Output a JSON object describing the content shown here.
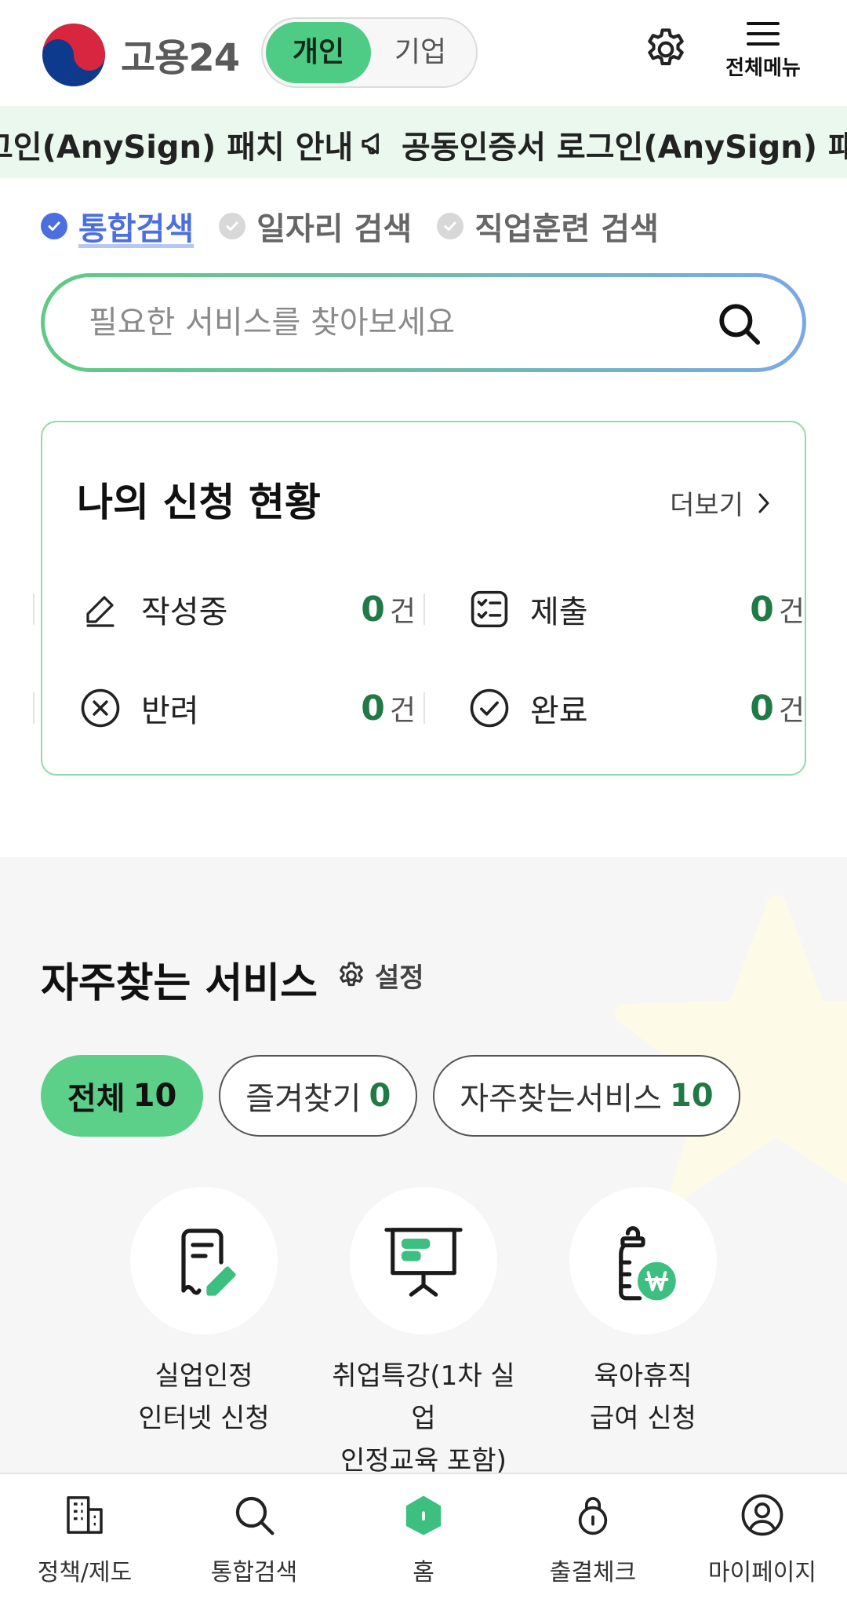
{
  "header": {
    "brand": "고용24",
    "toggle": {
      "personal": "개인",
      "business": "기업"
    },
    "menu_label": "전체메뉴"
  },
  "notice": {
    "text_1": "그인(AnySign) 패치 안내",
    "text_2": "공동인증서 로그인(AnySign) 패치"
  },
  "search_tabs": [
    "통합검색",
    "일자리 검색",
    "직업훈련 검색"
  ],
  "search": {
    "placeholder": "필요한 서비스를 찾아보세요"
  },
  "applications": {
    "title": "나의 신청 현황",
    "more": "더보기",
    "unit": "건",
    "items": [
      {
        "label": "작성중",
        "count": "0"
      },
      {
        "label": "제출",
        "count": "0"
      },
      {
        "label": "반려",
        "count": "0"
      },
      {
        "label": "완료",
        "count": "0"
      }
    ]
  },
  "frequent": {
    "title": "자주찾는 서비스",
    "settings": "설정",
    "chips": [
      {
        "label": "전체",
        "count": "10"
      },
      {
        "label": "즐겨찾기",
        "count": "0"
      },
      {
        "label": "자주찾는서비스",
        "count": "10"
      }
    ],
    "services": [
      {
        "line1": "실업인정",
        "line2": "인터넷 신청",
        "icon": "document-edit-icon"
      },
      {
        "line1": "취업특강(1차 실업",
        "line2": "인정교육 포함)",
        "icon": "presentation-board-icon"
      },
      {
        "line1": "육아휴직",
        "line2": "급여 신청",
        "icon": "baby-bottle-won-icon"
      }
    ]
  },
  "bottom_nav": [
    "정책/제도",
    "통합검색",
    "홈",
    "출결체크",
    "마이페이지"
  ],
  "colors": {
    "accent": "#4ecb84",
    "count": "#1f7a45",
    "tab_active": "#4b6fe0"
  }
}
